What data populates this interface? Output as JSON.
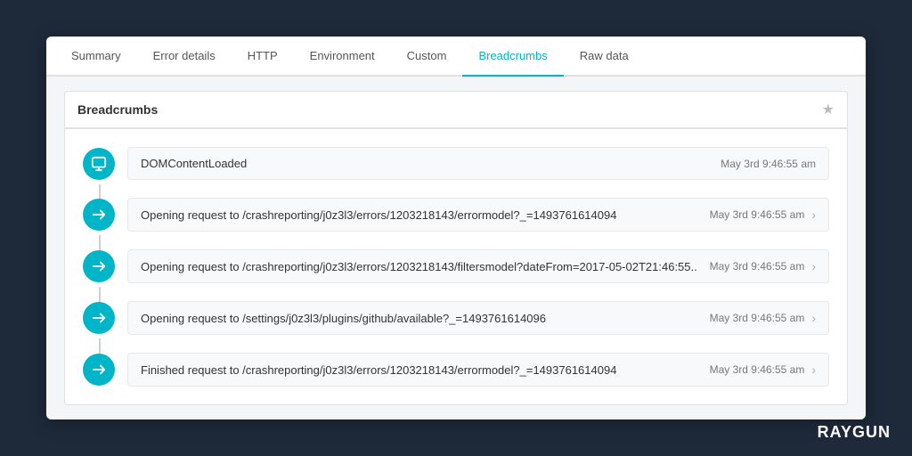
{
  "tabs": [
    {
      "label": "Summary",
      "active": false
    },
    {
      "label": "Error details",
      "active": false
    },
    {
      "label": "HTTP",
      "active": false
    },
    {
      "label": "Environment",
      "active": false
    },
    {
      "label": "Custom",
      "active": false
    },
    {
      "label": "Breadcrumbs",
      "active": true
    },
    {
      "label": "Raw data",
      "active": false
    }
  ],
  "section": {
    "title": "Breadcrumbs",
    "star_icon": "★"
  },
  "items": [
    {
      "type": "dom",
      "text": "DOMContentLoaded",
      "time": "May 3rd 9:46:55 am",
      "has_arrow": false
    },
    {
      "type": "request",
      "text": "Opening request to /crashreporting/j0z3l3/errors/1203218143/errormodel?_=1493761614094",
      "time": "May 3rd 9:46:55 am",
      "has_arrow": true
    },
    {
      "type": "request",
      "text": "Opening request to /crashreporting/j0z3l3/errors/1203218143/filtersmodel?dateFrom=2017-05-02T21:46:55..",
      "time": "May 3rd 9:46:55 am",
      "has_arrow": true
    },
    {
      "type": "request",
      "text": "Opening request to /settings/j0z3l3/plugins/github/available?_=1493761614096",
      "time": "May 3rd 9:46:55 am",
      "has_arrow": true
    },
    {
      "type": "request",
      "text": "Finished request to /crashreporting/j0z3l3/errors/1203218143/errormodel?_=1493761614094",
      "time": "May 3rd 9:46:55 am",
      "has_arrow": true
    }
  ],
  "logo": "RAYGUN"
}
